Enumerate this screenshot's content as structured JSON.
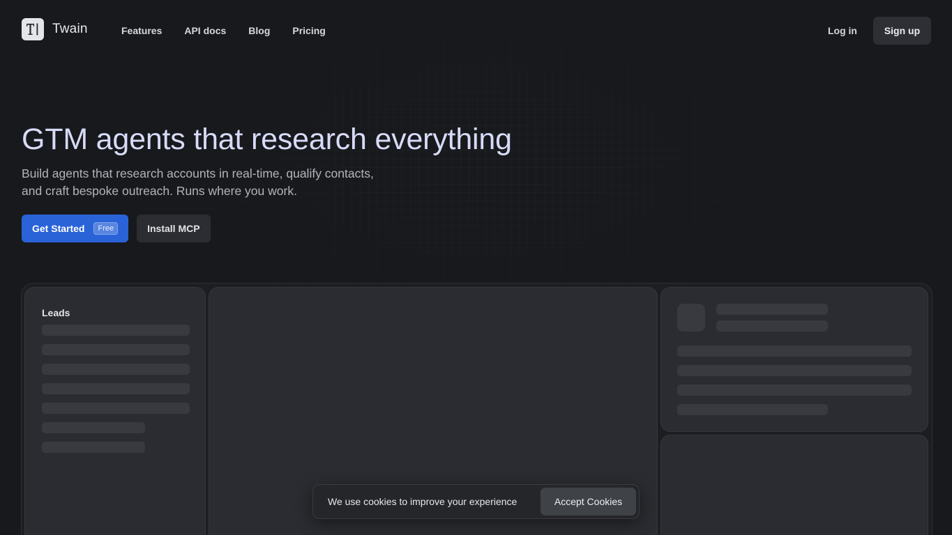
{
  "brand": {
    "name": "Twain",
    "logo_icon": "text-cursor-T-icon"
  },
  "nav": {
    "links": [
      "Features",
      "API docs",
      "Blog",
      "Pricing"
    ],
    "login": "Log in",
    "signup": "Sign up"
  },
  "hero": {
    "title": "GTM agents that research everything",
    "subtitle_line1": "Build agents that research accounts in real-time, qualify contacts,",
    "subtitle_line2": "and craft bespoke outreach. Runs where you work.",
    "primary_cta": "Get Started",
    "primary_badge": "Free",
    "secondary_cta": "Install MCP"
  },
  "preview": {
    "leads_title": "Leads"
  },
  "cookie": {
    "message": "We use cookies to improve your experience",
    "accept": "Accept Cookies"
  },
  "colors": {
    "background": "#18191d",
    "primary": "#2a63d8",
    "title": "#d7dbf7",
    "panel": "#2b2c31",
    "skeleton": "#393a3f"
  }
}
